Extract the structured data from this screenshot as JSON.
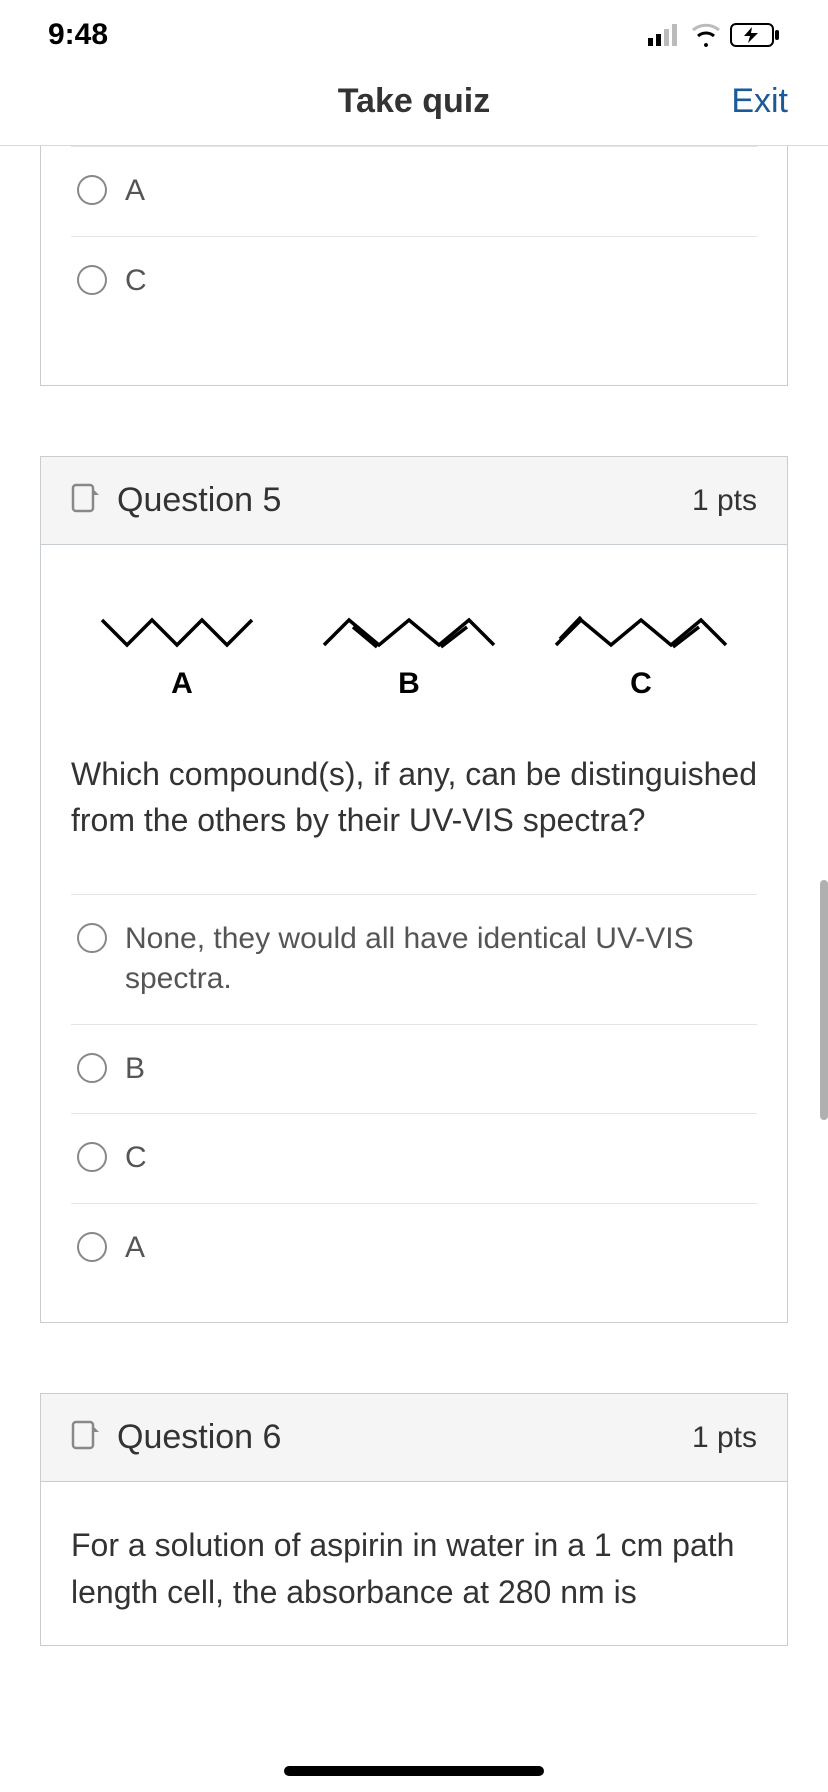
{
  "status": {
    "time": "9:48"
  },
  "nav": {
    "title": "Take quiz",
    "exit": "Exit"
  },
  "prev_question": {
    "options": [
      "A",
      "C"
    ]
  },
  "q5": {
    "title": "Question 5",
    "pts": "1 pts",
    "compounds": [
      "A",
      "B",
      "C"
    ],
    "text": "Which compound(s), if any, can be distinguished from the others by their UV-VIS spectra?",
    "options": [
      "None, they would all have identical UV-VIS spectra.",
      "B",
      "C",
      "A"
    ]
  },
  "q6": {
    "title": "Question 6",
    "pts": "1 pts",
    "text": "For a solution of aspirin in water in a 1 cm path length cell, the absorbance at 280 nm is"
  }
}
